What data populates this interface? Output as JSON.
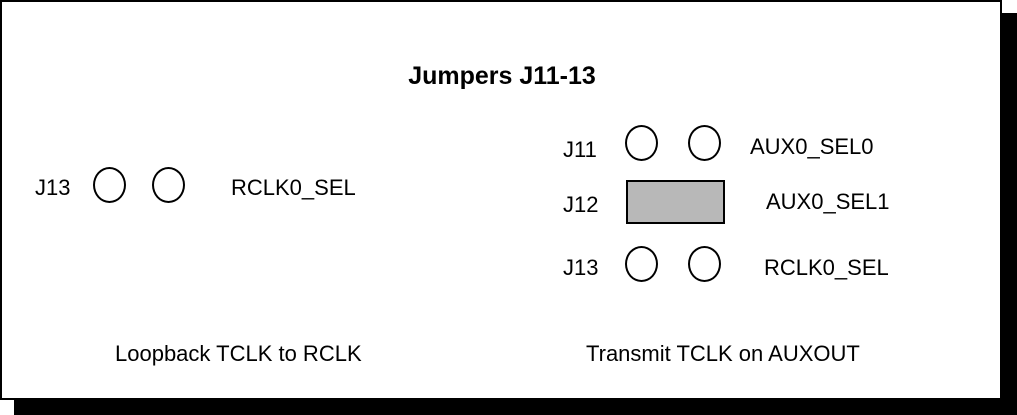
{
  "title": "Jumpers J11-13",
  "left": {
    "jumper_label": "J13",
    "signal_label": "RCLK0_SEL",
    "caption": "Loopback TCLK to RCLK"
  },
  "right": {
    "rows": [
      {
        "jumper_label": "J11",
        "signal_label": "AUX0_SEL0",
        "state": "open"
      },
      {
        "jumper_label": "J12",
        "signal_label": "AUX0_SEL1",
        "state": "shunted"
      },
      {
        "jumper_label": "J13",
        "signal_label": "RCLK0_SEL",
        "state": "open"
      }
    ],
    "caption": "Transmit TCLK on AUXOUT"
  },
  "colors": {
    "line": "#000000",
    "background": "#ffffff",
    "shunt_fill": "#d0d0d0"
  }
}
